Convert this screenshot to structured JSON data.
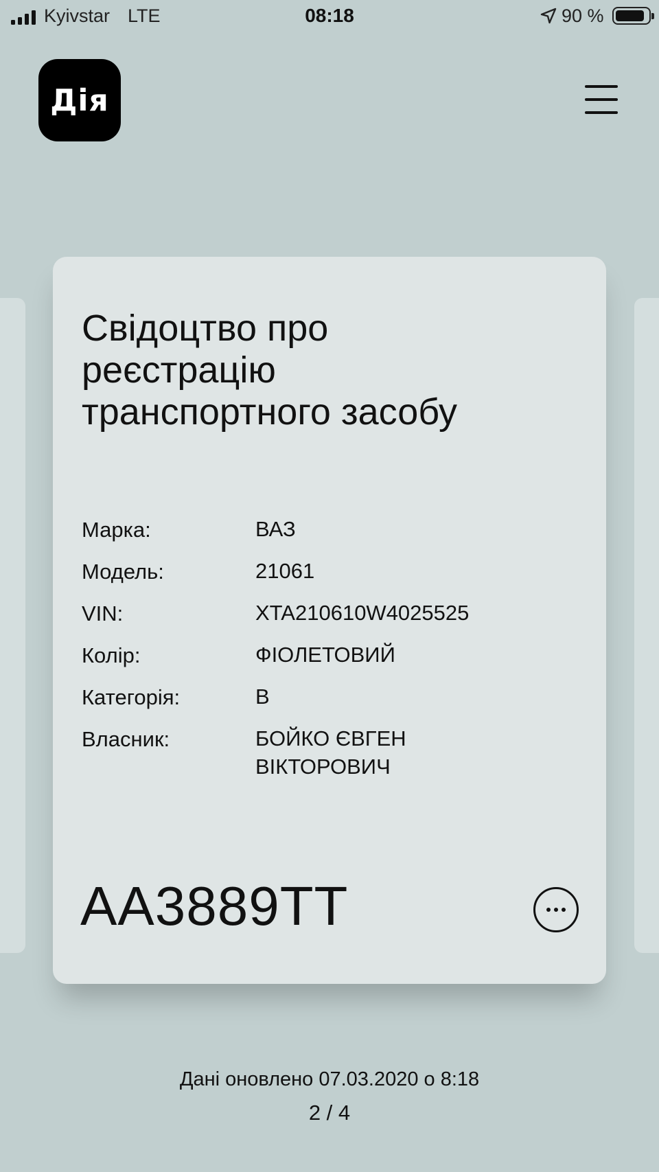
{
  "status_bar": {
    "carrier": "Kyivstar",
    "network": "LTE",
    "time": "08:18",
    "battery_percent": "90 %",
    "battery_level": 0.9
  },
  "header": {
    "logo_text": "Дія",
    "menu_icon": "hamburger-menu-icon"
  },
  "document": {
    "title": "Свідоцтво про реєстрацію транспортного засобу",
    "fields": {
      "make": {
        "label": "Марка:",
        "value": "ВАЗ"
      },
      "model": {
        "label": "Модель:",
        "value": "21061"
      },
      "vin": {
        "label": "VIN:",
        "value": "XTA210610W4025525"
      },
      "color": {
        "label": "Колір:",
        "value": "ФІОЛЕТОВИЙ"
      },
      "category": {
        "label": "Категорія:",
        "value": "B"
      },
      "owner": {
        "label": "Власник:",
        "value": "БОЙКО ЄВГЕН ВІКТОРОВИЧ"
      }
    },
    "plate_number": "AA3889TT",
    "more_icon": "more-options-icon"
  },
  "footer": {
    "updated_text": "Дані оновлено 07.03.2020 о 8:18",
    "page_indicator": "2 / 4"
  }
}
